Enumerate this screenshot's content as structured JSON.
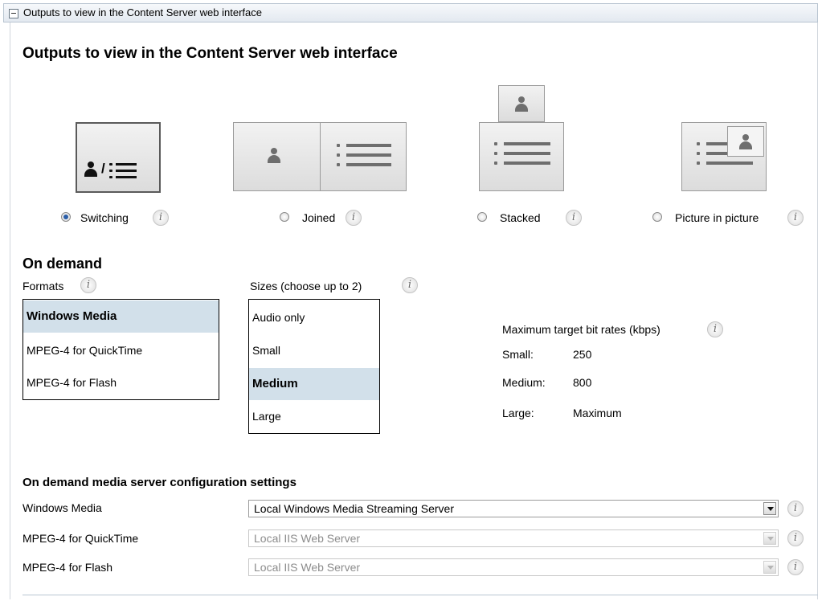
{
  "panel": {
    "header": "Outputs to view in the Content Server web interface",
    "title": "Outputs to view in the Content Server web interface"
  },
  "layouts": [
    {
      "label": "Switching",
      "selected": true,
      "icon_text": "/"
    },
    {
      "label": "Joined",
      "selected": false
    },
    {
      "label": "Stacked",
      "selected": false
    },
    {
      "label": "Picture in picture",
      "selected": false
    }
  ],
  "info_glyph": "i",
  "on_demand": {
    "title": "On demand",
    "formats_label": "Formats",
    "formats": [
      {
        "label": "Windows Media",
        "selected": true
      },
      {
        "label": "MPEG-4 for QuickTime",
        "selected": false
      },
      {
        "label": "MPEG-4 for Flash",
        "selected": false
      }
    ],
    "sizes_label": "Sizes (choose up to 2)",
    "sizes": [
      {
        "label": "Audio only",
        "selected": false
      },
      {
        "label": "Small",
        "selected": false
      },
      {
        "label": "Medium",
        "selected": true
      },
      {
        "label": "Large",
        "selected": false
      }
    ],
    "bitrates_label": "Maximum target bit rates (kbps)",
    "bitrates": [
      {
        "name": "Small:",
        "value": "250"
      },
      {
        "name": "Medium:",
        "value": "800"
      },
      {
        "name": "Large:",
        "value": "Maximum"
      }
    ]
  },
  "media_server": {
    "title": "On demand media server configuration settings",
    "rows": [
      {
        "label": "Windows Media",
        "value": "Local Windows Media Streaming Server",
        "enabled": true
      },
      {
        "label": "MPEG-4 for QuickTime",
        "value": "Local IIS Web Server",
        "enabled": false
      },
      {
        "label": "MPEG-4 for Flash",
        "value": "Local IIS Web Server",
        "enabled": false
      }
    ]
  },
  "colors": {
    "selected_row": "#d2e0ea",
    "radio_selected": "#2a5ea8",
    "disabled_text": "#8c8c8c"
  }
}
